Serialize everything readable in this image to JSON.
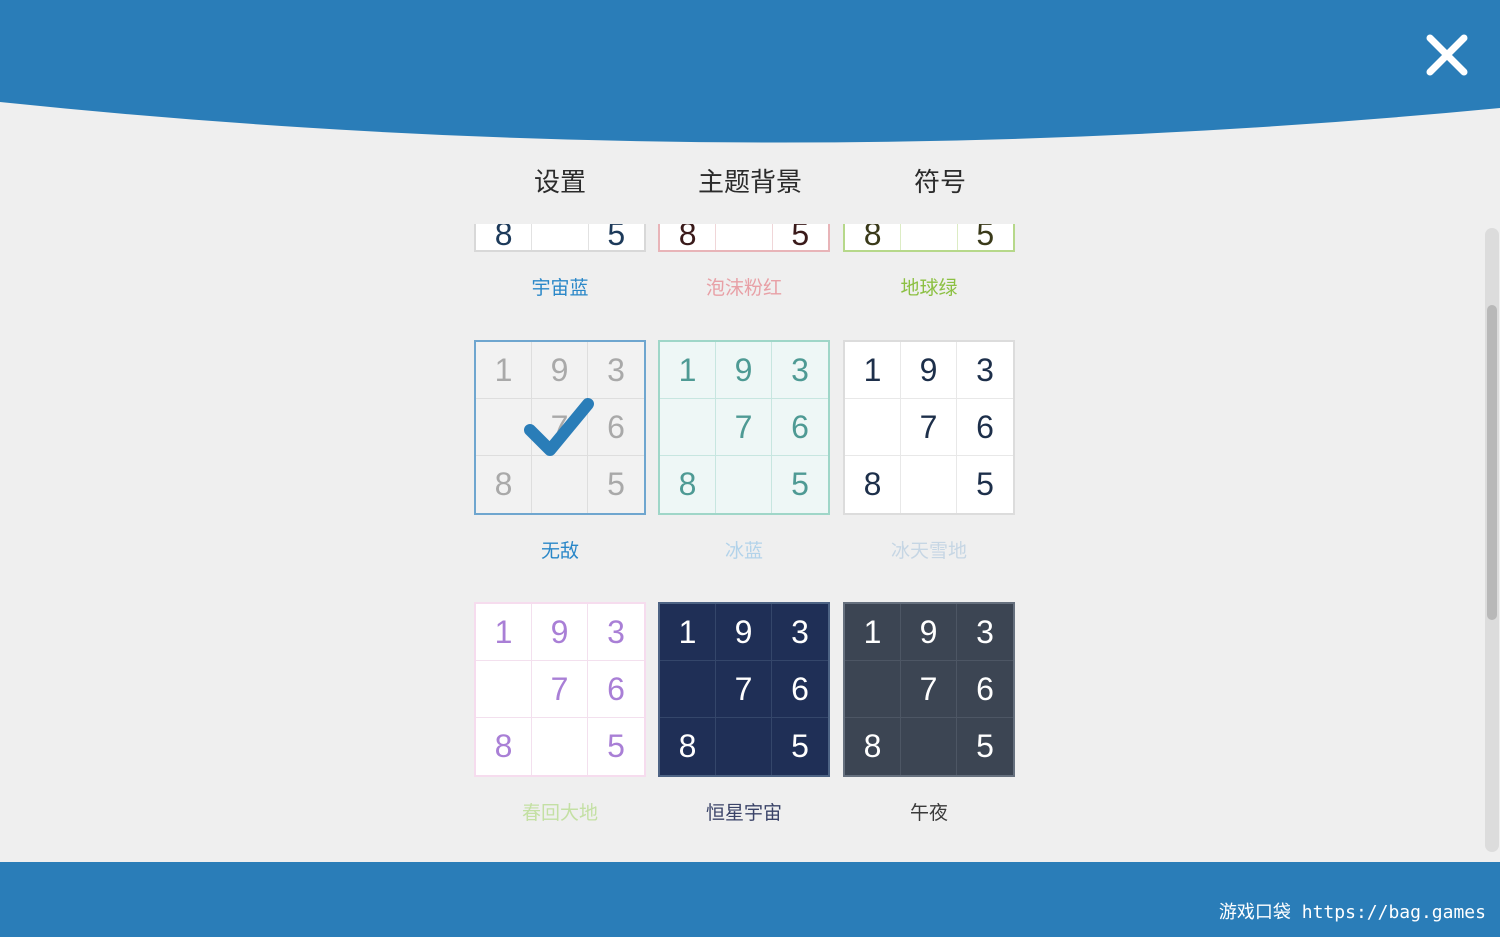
{
  "colors": {
    "primary_blue": "#2a7db8",
    "background": "#efefef"
  },
  "tabs": [
    {
      "label": "设置"
    },
    {
      "label": "主题背景"
    },
    {
      "label": "符号"
    }
  ],
  "sample_numbers": [
    "1",
    "9",
    "3",
    "",
    "7",
    "6",
    "8",
    "",
    "5"
  ],
  "partial_row": [
    {
      "label": "宇宙蓝",
      "digits": [
        "8",
        "",
        "5"
      ]
    },
    {
      "label": "泡沫粉红",
      "digits": [
        "8",
        "",
        "5"
      ]
    },
    {
      "label": "地球绿",
      "digits": [
        "8",
        "",
        "5"
      ]
    }
  ],
  "themes": [
    {
      "label": "无敌",
      "selected": true
    },
    {
      "label": "冰蓝",
      "selected": false
    },
    {
      "label": "冰天雪地",
      "selected": false
    },
    {
      "label": "春回大地",
      "selected": false
    },
    {
      "label": "恒星宇宙",
      "selected": false
    },
    {
      "label": "午夜",
      "selected": false
    }
  ],
  "icons": {
    "close": "close-icon",
    "selected": "checkmark-icon"
  },
  "watermark": "游戏口袋 https://bag.games"
}
